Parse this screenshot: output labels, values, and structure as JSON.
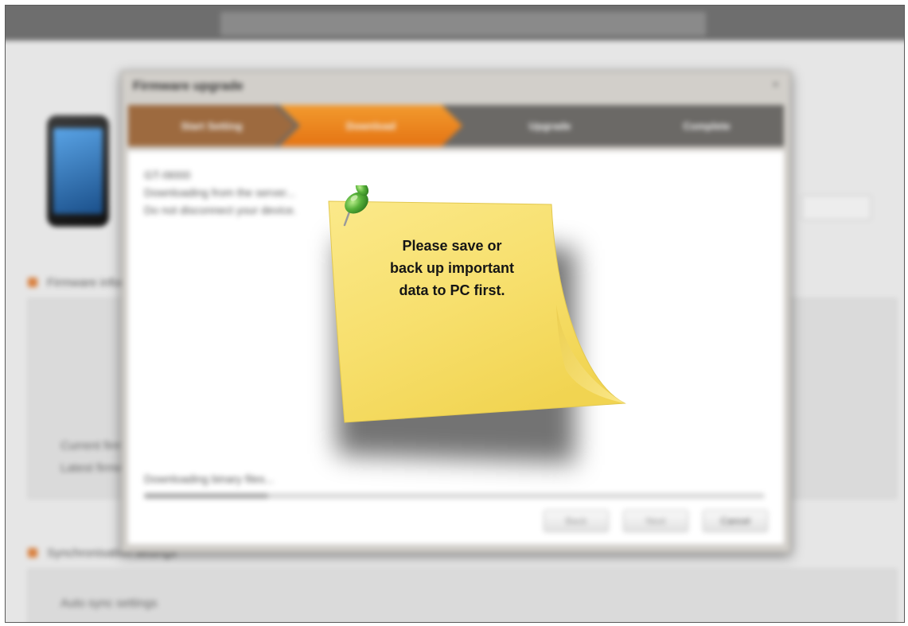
{
  "dialog": {
    "title": "Firmware upgrade",
    "close_symbol": "×",
    "steps": [
      {
        "label": "Start Setting",
        "state": "done"
      },
      {
        "label": "Download",
        "state": "active"
      },
      {
        "label": "Upgrade",
        "state": "pending"
      },
      {
        "label": "Complete",
        "state": "pending"
      }
    ],
    "info": {
      "model": "GT-I9000",
      "line1": "Downloading from the server...",
      "line2": "Do not disconnect your device."
    },
    "progress": {
      "label": "Downloading binary files...",
      "fraction": 0.2
    },
    "buttons": {
      "back": "Back",
      "next": "Next",
      "cancel": "Cancel"
    }
  },
  "note": {
    "line1": "Please save or",
    "line2": "back up important",
    "line3": "data to PC first."
  },
  "background": {
    "section1": "Firmware information",
    "section2": "Synchronisation settings",
    "panel_text_a": "Current firmware",
    "panel_text_b": "Latest firmware",
    "sync_text": "Auto sync settings"
  },
  "colors": {
    "step_done": "#9d6a3f",
    "step_active": "#ee8a22",
    "step_pending": "#6b6966",
    "note_yellow": "#f8e37a",
    "pin_green": "#4fa32e"
  },
  "icons": {
    "pin": "pushpin-icon",
    "phone": "phone-icon"
  }
}
